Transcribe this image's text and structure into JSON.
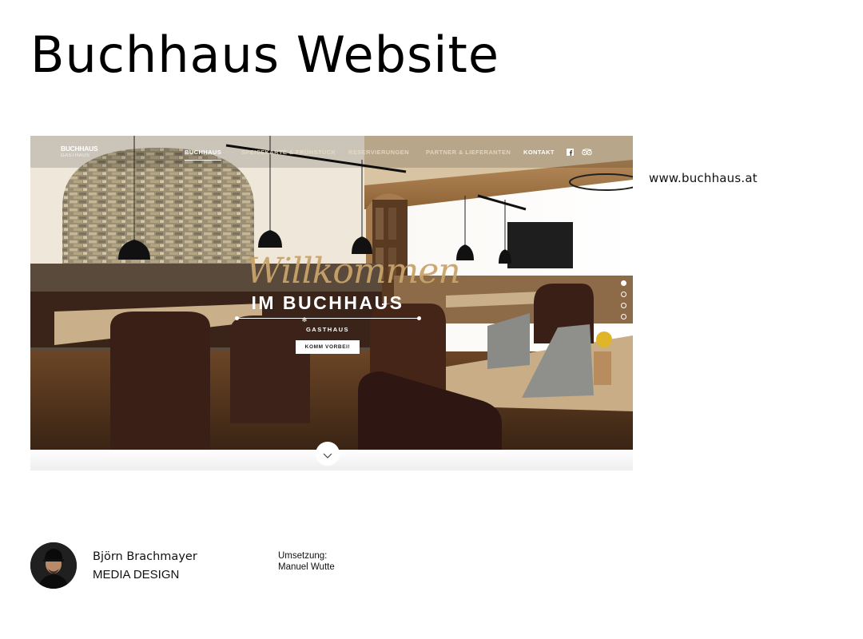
{
  "page": {
    "title": "Buchhaus Website",
    "url": "www.buchhaus.at"
  },
  "site": {
    "logo": {
      "line1": "BUCHHAUS",
      "line2": "GASTHAUS"
    },
    "nav": {
      "items": [
        {
          "label": "BUCHHAUS",
          "active": true
        },
        {
          "label": "SPEISEKARTE & FRÜHSTÜCK",
          "active": false
        },
        {
          "label": "RESERVIERUNGEN",
          "active": false
        },
        {
          "label": "PARTNER & LIEFERANTEN",
          "active": false
        },
        {
          "label": "KONTAKT",
          "active": false
        }
      ],
      "icons": [
        "facebook-icon",
        "tripadvisor-icon"
      ]
    },
    "hero": {
      "script": "Willkommen",
      "title": "IM BUCHHAUS",
      "subtitle": "GASTHAUS",
      "cta": "KOMM VORBEI!"
    },
    "slider": {
      "count": 4,
      "active_index": 0
    },
    "scroll_icon": "chevron-down-icon"
  },
  "footer": {
    "author_name": "Björn Brachmayer",
    "author_role": "MEDIA DESIGN",
    "credit_label": "Umsetzung:",
    "credit_name": "Manuel Wutte"
  }
}
